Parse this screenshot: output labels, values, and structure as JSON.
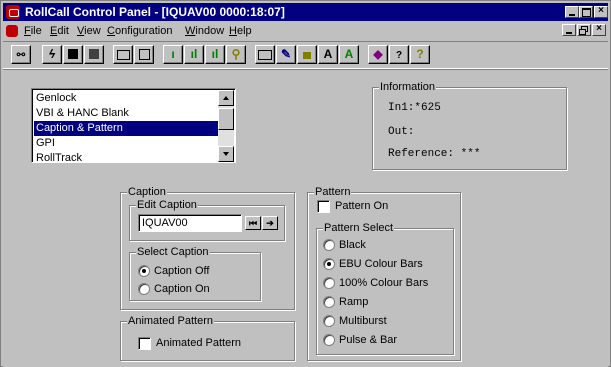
{
  "window": {
    "title": "RollCall Control Panel - [IQUAV00 0000:18:07]"
  },
  "menu": [
    "File",
    "Edit",
    "View",
    "Configuration",
    "Window",
    "Help"
  ],
  "toolbar": {
    "buttons": [
      "link",
      "lightning",
      "save",
      "save-all",
      "monitor",
      "monitor-split",
      "bars-1",
      "bars-2",
      "bars-3",
      "key",
      "book",
      "edit",
      "lock",
      "A",
      "A-green",
      "eraser",
      "help",
      "question"
    ]
  },
  "list": {
    "items": [
      "Genlock",
      "VBI & HANC Blank",
      "Caption & Pattern",
      "GPI",
      "RollTrack"
    ],
    "selected": "Caption & Pattern"
  },
  "information": {
    "legend": "Information",
    "in_label": "In1:*625",
    "out_label": "Out:",
    "reference_label": "Reference: ***"
  },
  "caption": {
    "legend": "Caption",
    "edit_legend": "Edit Caption",
    "edit_value": "IQUAV00",
    "select_legend": "Select Caption",
    "options": [
      "Caption Off",
      "Caption On"
    ],
    "selected": "Caption Off"
  },
  "animated": {
    "legend": "Animated Pattern",
    "checkbox_label": "Animated Pattern",
    "checked": false
  },
  "pattern": {
    "legend": "Pattern",
    "pattern_on_label": "Pattern On",
    "pattern_on_checked": false,
    "select_legend": "Pattern Select",
    "options": [
      "Black",
      "EBU Colour Bars",
      "100% Colour Bars",
      "Ramp",
      "Multiburst",
      "Pulse & Bar"
    ],
    "selected": "EBU Colour Bars"
  }
}
